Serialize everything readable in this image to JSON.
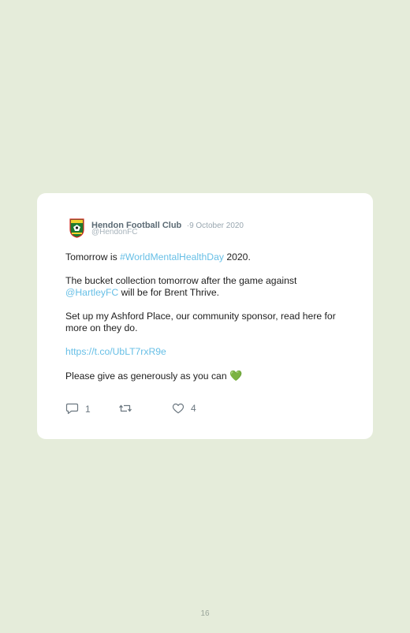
{
  "tweet": {
    "author_name": "Hendon Football Club",
    "separator": "·",
    "date": "9 October 2020",
    "handle": "@HendonFC",
    "p1_before": "Tomorrow is ",
    "p1_hashtag": "#WorldMentalHealthDay",
    "p1_after": " 2020.",
    "p2_before": "The bucket collection tomorrow after the game against ",
    "p2_mention": "@HartleyFC",
    "p2_after": " will be for Brent Thrive.",
    "p3": "Set up my Ashford Place, our community sponsor, read here for more on they do.",
    "p4_link": "https://t.co/UbLT7rxR9e",
    "p5": "Please give as generously as you can",
    "p5_emoji": "💚",
    "reply_count": "1",
    "retweet_count": "",
    "like_count": "4"
  },
  "page": {
    "number": "16"
  },
  "colors": {
    "background": "#e5ecda",
    "card": "#ffffff",
    "link": "#67bfe6",
    "text": "#1e1e1e"
  },
  "icons": {
    "avatar": "club-crest",
    "reply": "speech-bubble-icon",
    "retweet": "retweet-icon",
    "like": "heart-icon"
  }
}
